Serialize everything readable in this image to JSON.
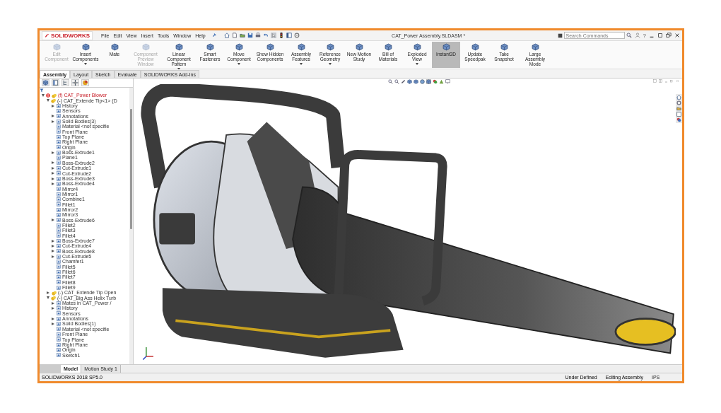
{
  "window": {
    "logo": "SOLIDWORKS",
    "title": "CAT_Power Assembly.SLDASM *",
    "help": "?"
  },
  "menu": [
    "File",
    "Edit",
    "View",
    "Insert",
    "Tools",
    "Window",
    "Help"
  ],
  "search": {
    "placeholder": "Search Commands"
  },
  "ribbon": [
    {
      "label": "Edit Component",
      "disabled": true,
      "selected": false,
      "has_menu": false
    },
    {
      "label": "Insert Components",
      "disabled": false,
      "selected": false,
      "has_menu": true
    },
    {
      "label": "Mate",
      "disabled": false,
      "selected": false,
      "has_menu": false
    },
    {
      "label": "Component Preview Window",
      "disabled": true,
      "selected": false,
      "has_menu": false
    },
    {
      "label": "Linear Component Pattern",
      "disabled": false,
      "selected": false,
      "has_menu": true
    },
    {
      "label": "Smart Fasteners",
      "disabled": false,
      "selected": false,
      "has_menu": false
    },
    {
      "label": "Move Component",
      "disabled": false,
      "selected": false,
      "has_menu": true
    },
    {
      "label": "Show Hidden Components",
      "disabled": false,
      "selected": false,
      "has_menu": false
    },
    {
      "label": "Assembly Features",
      "disabled": false,
      "selected": false,
      "has_menu": true
    },
    {
      "label": "Reference Geometry",
      "disabled": false,
      "selected": false,
      "has_menu": true
    },
    {
      "label": "New Motion Study",
      "disabled": false,
      "selected": false,
      "has_menu": false
    },
    {
      "label": "Bill of Materials",
      "disabled": false,
      "selected": false,
      "has_menu": false
    },
    {
      "label": "Exploded View",
      "disabled": false,
      "selected": false,
      "has_menu": true
    },
    {
      "label": "Instant3D",
      "disabled": false,
      "selected": true,
      "has_menu": false
    },
    {
      "label": "Update Speedpak",
      "disabled": false,
      "selected": false,
      "has_menu": false
    },
    {
      "label": "Take Snapshot",
      "disabled": false,
      "selected": false,
      "has_menu": false
    },
    {
      "label": "Large Assembly Mode",
      "disabled": false,
      "selected": false,
      "has_menu": false
    }
  ],
  "tabs": [
    {
      "label": "Assembly",
      "selected": true
    },
    {
      "label": "Layout",
      "selected": false
    },
    {
      "label": "Sketch",
      "selected": false
    },
    {
      "label": "Evaluate",
      "selected": false
    },
    {
      "label": "SOLIDWORKS Add-Ins",
      "selected": false
    }
  ],
  "tree": [
    {
      "label": "(f) CAT_Power Blower",
      "error": true,
      "expanded": true,
      "children": [
        {
          "label": "(-) CAT_Extende Tip<1> (D",
          "error": false,
          "expanded": true,
          "children": [
            {
              "label": "History",
              "expanded": false
            },
            {
              "label": "Sensors"
            },
            {
              "label": "Annotations",
              "expanded": false
            },
            {
              "label": "Solid Bodies(3)",
              "expanded": false
            },
            {
              "label": "Material <not specifie"
            },
            {
              "label": "Front Plane"
            },
            {
              "label": "Top Plane"
            },
            {
              "label": "Right Plane"
            },
            {
              "label": "Origin"
            },
            {
              "label": "Boss-Extrude1",
              "expanded": false
            },
            {
              "label": "Plane1"
            },
            {
              "label": "Boss-Extrude2",
              "expanded": false
            },
            {
              "label": "Cut-Extrude1",
              "expanded": false
            },
            {
              "label": "Cut-Extrude2",
              "expanded": false
            },
            {
              "label": "Boss-Extrude3",
              "expanded": false
            },
            {
              "label": "Boss-Extrude4",
              "expanded": false
            },
            {
              "label": "Mirror4"
            },
            {
              "label": "Mirror1"
            },
            {
              "label": "Combine1"
            },
            {
              "label": "Fillet1"
            },
            {
              "label": "Mirror2"
            },
            {
              "label": "Mirror3"
            },
            {
              "label": "Boss-Extrude6",
              "expanded": false
            },
            {
              "label": "Fillet2"
            },
            {
              "label": "Fillet3"
            },
            {
              "label": "Fillet4"
            },
            {
              "label": "Boss-Extrude7",
              "expanded": false
            },
            {
              "label": "Cut-Extrude4",
              "expanded": false
            },
            {
              "label": "Boss-Extrude8",
              "expanded": false
            },
            {
              "label": "Cut-Extrude5",
              "expanded": false
            },
            {
              "label": "Chamfer1"
            },
            {
              "label": "Fillet5"
            },
            {
              "label": "Fillet6"
            },
            {
              "label": "Fillet7"
            },
            {
              "label": "Fillet8"
            },
            {
              "label": "Fillet9"
            }
          ]
        },
        {
          "label": "(-) CAT_Extende Tip Open",
          "error": false,
          "expanded": false
        },
        {
          "label": "(-) CAT_Big Ass Helix Turb",
          "error": false,
          "expanded": true,
          "children": [
            {
              "label": "Mates in CAT_Power /",
              "expanded": false
            },
            {
              "label": "History",
              "expanded": false
            },
            {
              "label": "Sensors"
            },
            {
              "label": "Annotations",
              "expanded": false
            },
            {
              "label": "Solid Bodies(1)",
              "expanded": false
            },
            {
              "label": "Material <not specifie"
            },
            {
              "label": "Front Plane"
            },
            {
              "label": "Top Plane"
            },
            {
              "label": "Right Plane"
            },
            {
              "label": "Origin"
            },
            {
              "label": "Sketch1"
            }
          ]
        }
      ]
    }
  ],
  "bottom_tabs": [
    {
      "label": "Model",
      "selected": true
    },
    {
      "label": "Motion Study 1",
      "selected": false
    }
  ],
  "status_bar": {
    "version": "SOLIDWORKS 2018 SP5.0",
    "state": "Under Defined",
    "mode": "Editing Assembly",
    "units": "IPS"
  }
}
